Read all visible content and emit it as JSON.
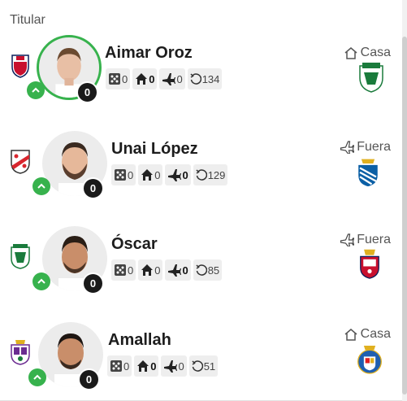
{
  "section": {
    "title": "Titular"
  },
  "players": [
    {
      "name": "Aimar Oroz",
      "points": "0",
      "starter": true,
      "stats": {
        "dice": "0",
        "home": "0",
        "away": "0",
        "history": "134"
      },
      "venue": {
        "label": "Casa",
        "icon": "home-icon"
      },
      "team_colors": [
        "#c8102e",
        "#0b1e5b"
      ],
      "opponent_colors": [
        "#1a7b3c",
        "#ffffff"
      ]
    },
    {
      "name": "Unai López",
      "points": "0",
      "starter": false,
      "stats": {
        "dice": "0",
        "home": "0",
        "away": "0",
        "history": "129"
      },
      "venue": {
        "label": "Fuera",
        "icon": "plane-icon"
      },
      "team_colors": [
        "#d8262e",
        "#ffffff"
      ],
      "opponent_colors": [
        "#0b5fa5",
        "#ffffff"
      ]
    },
    {
      "name": "Óscar",
      "points": "0",
      "starter": false,
      "stats": {
        "dice": "0",
        "home": "0",
        "away": "0",
        "history": "85"
      },
      "venue": {
        "label": "Fuera",
        "icon": "plane-icon"
      },
      "team_colors": [
        "#1a7b3c",
        "#ffffff"
      ],
      "opponent_colors": [
        "#c8102e",
        "#0b1e5b"
      ]
    },
    {
      "name": "Amallah",
      "points": "0",
      "starter": false,
      "stats": {
        "dice": "0",
        "home": "0",
        "away": "0",
        "history": "51"
      },
      "venue": {
        "label": "Casa",
        "icon": "home-icon"
      },
      "team_colors": [
        "#6b2c91",
        "#ffffff"
      ],
      "opponent_colors": [
        "#1f5fb0",
        "#e02020"
      ]
    }
  ]
}
